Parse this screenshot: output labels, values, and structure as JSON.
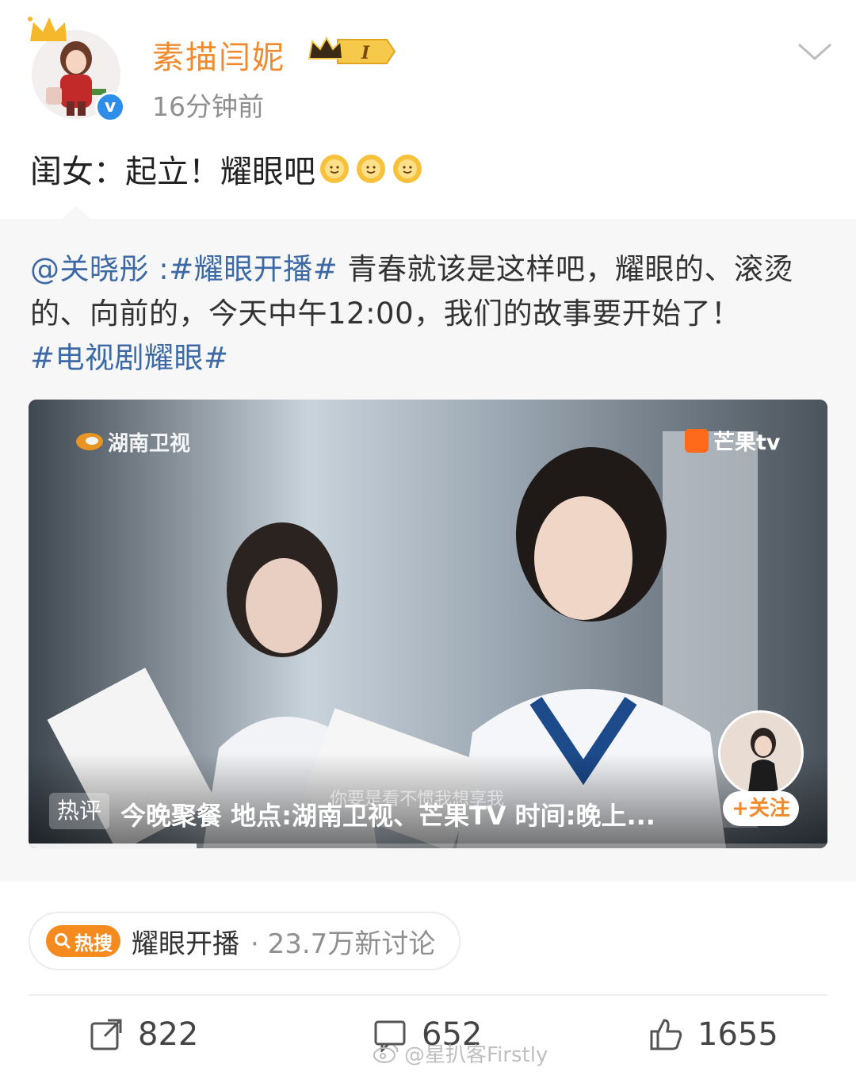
{
  "post": {
    "username": "素描闫妮",
    "vip_level": "I",
    "timestamp": "16分钟前",
    "text": "闺女：起立！耀眼吧",
    "emoji": [
      "sun-smile-icon",
      "sun-smile-icon",
      "sun-smile-icon"
    ]
  },
  "repost": {
    "mention": "@关晓彤",
    "separator": " :",
    "topic1": "#耀眼开播#",
    "body": " 青春就该是这样吧，耀眼的、滚烫的、向前的，今天中午12:00，我们的故事要开始了！",
    "topic2": "#电视剧耀眼#"
  },
  "video": {
    "logo_left": "湖南卫视",
    "logo_right": "芒果tv",
    "subtitle": "你要是看不惯我想享我",
    "hot_label": "热评",
    "hot_comment": "今晚聚餐 地点:湖南卫视、芒果TV 时间:晚上...",
    "follow_label": "+关注",
    "progress": 0.21
  },
  "hot_search": {
    "badge": "热搜",
    "title": "耀眼开播",
    "meta": "· 23.7万新讨论"
  },
  "actions": {
    "repost_count": "822",
    "comment_count": "652",
    "like_count": "1655"
  },
  "watermark": "@星扒客Firstly",
  "colors": {
    "username": "#f08a2c",
    "link": "#3d6aa4",
    "hot_badge": "#f58a1f",
    "verified": "#2c8ee8"
  }
}
